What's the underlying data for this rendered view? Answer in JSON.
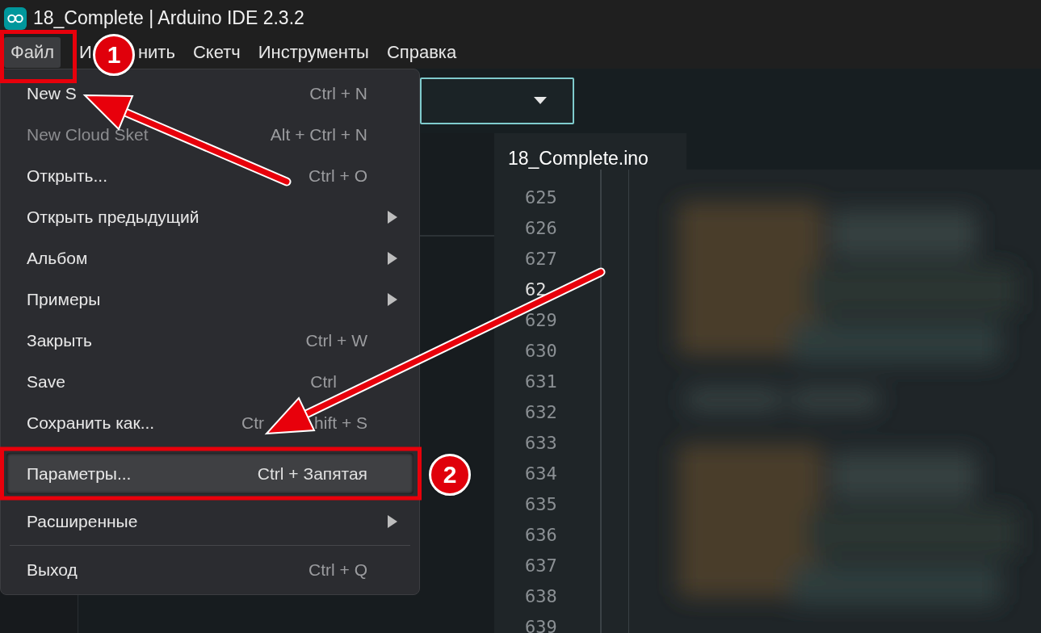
{
  "window": {
    "title": "18_Complete | Arduino IDE 2.3.2"
  },
  "menubar": [
    {
      "label_parts": [
        "Файл"
      ],
      "selected": true
    },
    {
      "label_parts": [
        "И",
        "нить"
      ],
      "selected": false
    },
    {
      "label_parts": [
        "Скетч"
      ],
      "selected": false
    },
    {
      "label_parts": [
        "Инструменты"
      ],
      "selected": false
    },
    {
      "label_parts": [
        "Справка"
      ],
      "selected": false
    }
  ],
  "file_menu": [
    {
      "label": "New S",
      "shortcut": [
        "Ctrl + N"
      ],
      "submenu": false,
      "disabled": false,
      "selected": false,
      "separator_before": false
    },
    {
      "label": "New Cloud Sket",
      "shortcut": [
        "Alt + Ctrl + N"
      ],
      "submenu": false,
      "disabled": true,
      "selected": false,
      "separator_before": false
    },
    {
      "label": "Открыть...",
      "shortcut": [
        "Ctrl + O"
      ],
      "submenu": false,
      "disabled": false,
      "selected": false,
      "separator_before": false
    },
    {
      "label": "Открыть предыдущий",
      "submenu": true,
      "disabled": false,
      "selected": false,
      "separator_before": false
    },
    {
      "label": "Альбом",
      "submenu": true,
      "disabled": false,
      "selected": false,
      "separator_before": false
    },
    {
      "label": "Примеры",
      "submenu": true,
      "disabled": false,
      "selected": false,
      "separator_before": false
    },
    {
      "label": "Закрыть",
      "shortcut": [
        "Ctrl + W"
      ],
      "submenu": false,
      "disabled": false,
      "selected": false,
      "separator_before": false
    },
    {
      "label": "Save",
      "shortcut": [
        "Ctrl"
      ],
      "shortcut_tail_hidden": true,
      "submenu": false,
      "disabled": false,
      "selected": false,
      "separator_before": false
    },
    {
      "label": "Сохранить как...",
      "shortcut": [
        "Ctr",
        "hift + S"
      ],
      "submenu": false,
      "disabled": false,
      "selected": false,
      "separator_before": false
    },
    {
      "label": "Параметры...",
      "shortcut": [
        "Ctrl + Запятая"
      ],
      "submenu": false,
      "disabled": false,
      "selected": true,
      "separator_before": false
    },
    {
      "label": "Расширенные",
      "submenu": true,
      "disabled": false,
      "selected": false,
      "separator_before": false
    },
    {
      "label": "Выход",
      "shortcut": [
        "Ctrl + Q"
      ],
      "submenu": false,
      "disabled": false,
      "selected": false,
      "separator_before": true
    }
  ],
  "editor": {
    "tab": {
      "label": "18_Complete.ino",
      "selected": true
    },
    "line_numbers": [
      {
        "number": "625",
        "current": false
      },
      {
        "number": "626",
        "current": false
      },
      {
        "number": "627",
        "current": false
      },
      {
        "number": "62",
        "current": true
      },
      {
        "number": "629",
        "current": false
      },
      {
        "number": "630",
        "current": false
      },
      {
        "number": "631",
        "current": false
      },
      {
        "number": "632",
        "current": false
      },
      {
        "number": "633",
        "current": false
      },
      {
        "number": "634",
        "current": false
      },
      {
        "number": "635",
        "current": false
      },
      {
        "number": "636",
        "current": false
      },
      {
        "number": "637",
        "current": false
      },
      {
        "number": "638",
        "current": false
      },
      {
        "number": "639",
        "current": false
      }
    ]
  },
  "annotations": {
    "badges": [
      {
        "label": "1"
      },
      {
        "label": "2"
      }
    ]
  }
}
